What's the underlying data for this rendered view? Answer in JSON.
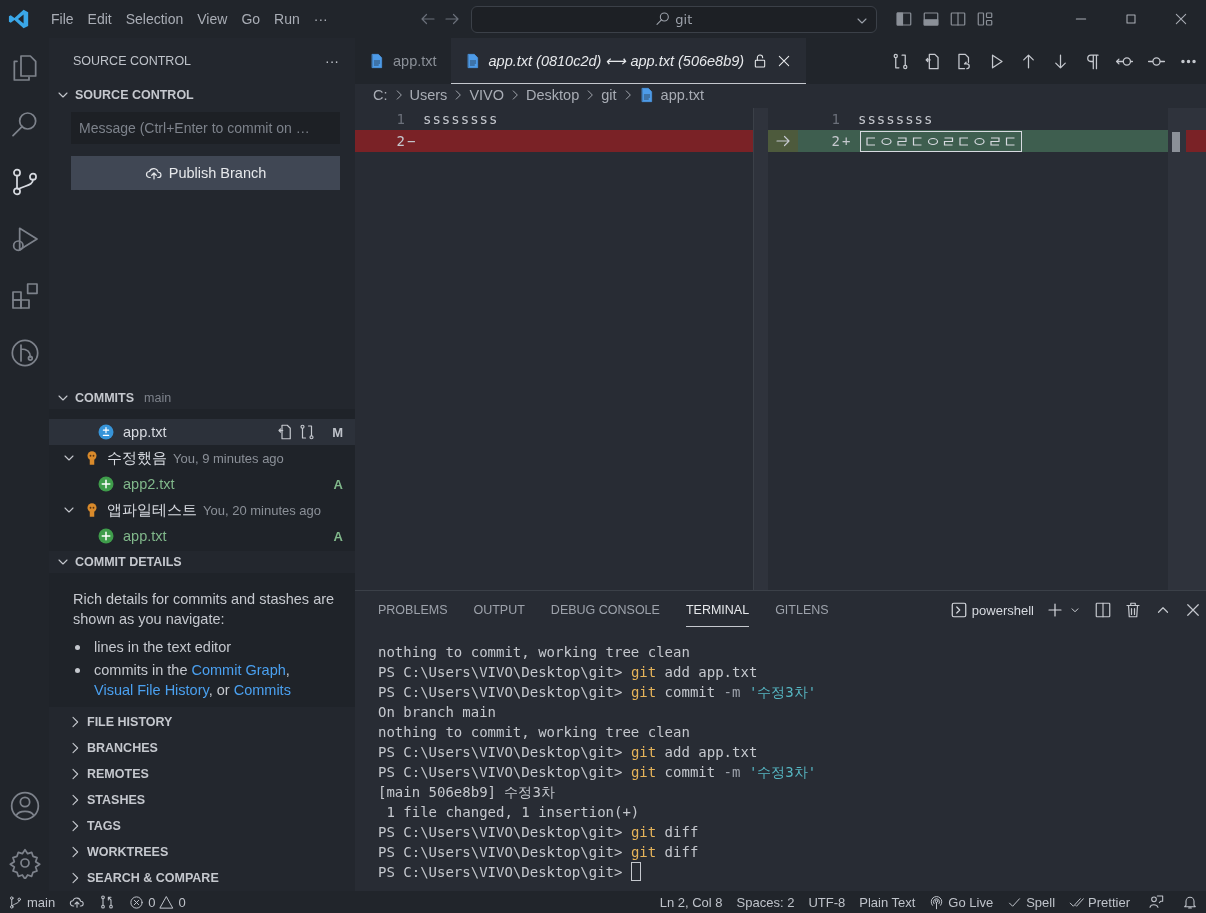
{
  "menu": [
    "File",
    "Edit",
    "Selection",
    "View",
    "Go",
    "Run",
    "···"
  ],
  "command_center": {
    "value": "git"
  },
  "activity_bar": [
    {
      "kind": "files",
      "selected": false
    },
    {
      "kind": "search",
      "selected": false
    },
    {
      "kind": "source-control",
      "selected": true
    },
    {
      "kind": "debug",
      "selected": false
    },
    {
      "kind": "extensions",
      "selected": false
    },
    {
      "kind": "gitlens",
      "selected": false
    }
  ],
  "sidebar": {
    "title": "SOURCE CONTROL",
    "more": "···",
    "source_control": {
      "title": "SOURCE CONTROL",
      "expanded": true,
      "message": {
        "placeholder": "Message (Ctrl+Enter to commit on …"
      },
      "button": "Publish Branch"
    },
    "commits": {
      "title": "COMMITS",
      "branch": "main",
      "expanded": true,
      "items": [
        {
          "kind": "file",
          "name": "app.txt",
          "status": "M",
          "modified": true,
          "selected": true
        },
        {
          "kind": "commit",
          "message": "수정했음",
          "meta": "You, 9 minutes ago",
          "expanded": true
        },
        {
          "kind": "file",
          "name": "app2.txt",
          "status": "A",
          "modified": false,
          "selected": false
        },
        {
          "kind": "commit",
          "message": "앱파일테스트",
          "meta": "You, 20 minutes ago",
          "expanded": true
        },
        {
          "kind": "file",
          "name": "app.txt",
          "status": "A",
          "modified": false,
          "selected": false
        }
      ]
    },
    "commit_details": {
      "title": "COMMIT DETAILS",
      "expanded": true,
      "intro": "Rich details for commits and stashes are shown as you navigate:",
      "bullets": [
        [
          {
            "text": "lines in the text editor",
            "link": false
          }
        ],
        [
          {
            "text": "commits in the ",
            "link": false
          },
          {
            "text": "Commit Graph",
            "link": true
          },
          {
            "text": ", ",
            "link": false
          },
          {
            "text": "Visual File History",
            "link": true
          },
          {
            "text": ", or ",
            "link": false
          },
          {
            "text": "Commits",
            "link": true
          }
        ]
      ]
    },
    "collapsed_sections": [
      {
        "title": "FILE HISTORY",
        "expanded": false
      },
      {
        "title": "BRANCHES",
        "expanded": false
      },
      {
        "title": "REMOTES",
        "expanded": false
      },
      {
        "title": "STASHES",
        "expanded": false
      },
      {
        "title": "TAGS",
        "expanded": false
      },
      {
        "title": "WORKTREES",
        "expanded": false
      },
      {
        "title": "SEARCH & COMPARE",
        "expanded": false
      }
    ]
  },
  "tabs": [
    {
      "label": "app.txt",
      "selected": false,
      "preview": false
    },
    {
      "label": "app.txt (0810c2d) ⟷ app.txt (506e8b9)",
      "selected": true,
      "preview": true
    }
  ],
  "breadcrumb": [
    "C:",
    "Users",
    "VIVO",
    "Desktop",
    "git",
    "app.txt"
  ],
  "diff": {
    "left": [
      {
        "number": "1",
        "text": "ssssssss",
        "kind": "normal"
      },
      {
        "number": "2",
        "marker": "−",
        "kind": "removed"
      }
    ],
    "right": [
      {
        "number": "1",
        "text": "ssssssss",
        "kind": "normal"
      },
      {
        "number": "2",
        "marker": "+",
        "kind": "added",
        "glyph_box": true
      }
    ]
  },
  "panel": {
    "tabs": [
      {
        "label": "PROBLEMS",
        "selected": false
      },
      {
        "label": "OUTPUT",
        "selected": false
      },
      {
        "label": "DEBUG CONSOLE",
        "selected": false
      },
      {
        "label": "TERMINAL",
        "selected": true
      },
      {
        "label": "GITLENS",
        "selected": false
      }
    ],
    "terminal_name": "powershell",
    "terminal": [
      [
        {
          "text": "nothing to commit, working tree clean",
          "kind": "plain"
        }
      ],
      [
        {
          "text": "PS C:\\Users\\VIVO\\Desktop\\git> ",
          "kind": "plain"
        },
        {
          "text": "git",
          "kind": "command"
        },
        {
          "text": " add app.txt",
          "kind": "plain"
        }
      ],
      [
        {
          "text": "PS C:\\Users\\VIVO\\Desktop\\git> ",
          "kind": "plain"
        },
        {
          "text": "git",
          "kind": "command"
        },
        {
          "text": " commit ",
          "kind": "plain"
        },
        {
          "text": "-m ",
          "kind": "flag"
        },
        {
          "text": "'수정3차'",
          "kind": "string"
        }
      ],
      [
        {
          "text": "On branch main",
          "kind": "plain"
        }
      ],
      [
        {
          "text": "nothing to commit, working tree clean",
          "kind": "plain"
        }
      ],
      [
        {
          "text": "PS C:\\Users\\VIVO\\Desktop\\git> ",
          "kind": "plain"
        },
        {
          "text": "git",
          "kind": "command"
        },
        {
          "text": " add app.txt",
          "kind": "plain"
        }
      ],
      [
        {
          "text": "PS C:\\Users\\VIVO\\Desktop\\git> ",
          "kind": "plain"
        },
        {
          "text": "git",
          "kind": "command"
        },
        {
          "text": " commit ",
          "kind": "plain"
        },
        {
          "text": "-m ",
          "kind": "flag"
        },
        {
          "text": "'수정3차'",
          "kind": "string"
        }
      ],
      [
        {
          "text": "[main 506e8b9] 수정3차",
          "kind": "plain"
        }
      ],
      [
        {
          "text": " 1 file changed, 1 insertion(+)",
          "kind": "plain"
        }
      ],
      [
        {
          "text": "PS C:\\Users\\VIVO\\Desktop\\git> ",
          "kind": "plain"
        },
        {
          "text": "git",
          "kind": "command"
        },
        {
          "text": " diff",
          "kind": "plain"
        }
      ],
      [
        {
          "text": "PS C:\\Users\\VIVO\\Desktop\\git> ",
          "kind": "plain"
        },
        {
          "text": "git",
          "kind": "command"
        },
        {
          "text": " diff",
          "kind": "plain"
        }
      ],
      [
        {
          "text": "PS C:\\Users\\VIVO\\Desktop\\git> ",
          "kind": "plain",
          "cursor": true
        }
      ]
    ]
  },
  "status_bar": {
    "branch": "main",
    "errors": "0",
    "warnings": "0",
    "right": [
      {
        "text": "Ln 2, Col 8",
        "kind": "text"
      },
      {
        "text": "Spaces: 2",
        "kind": "text"
      },
      {
        "text": "UTF-8",
        "kind": "text"
      },
      {
        "text": "Plain Text",
        "kind": "text"
      },
      {
        "text": "Go Live",
        "kind": "live"
      },
      {
        "text": "Spell",
        "kind": "spell"
      },
      {
        "text": "Prettier",
        "kind": "prettier"
      }
    ]
  }
}
